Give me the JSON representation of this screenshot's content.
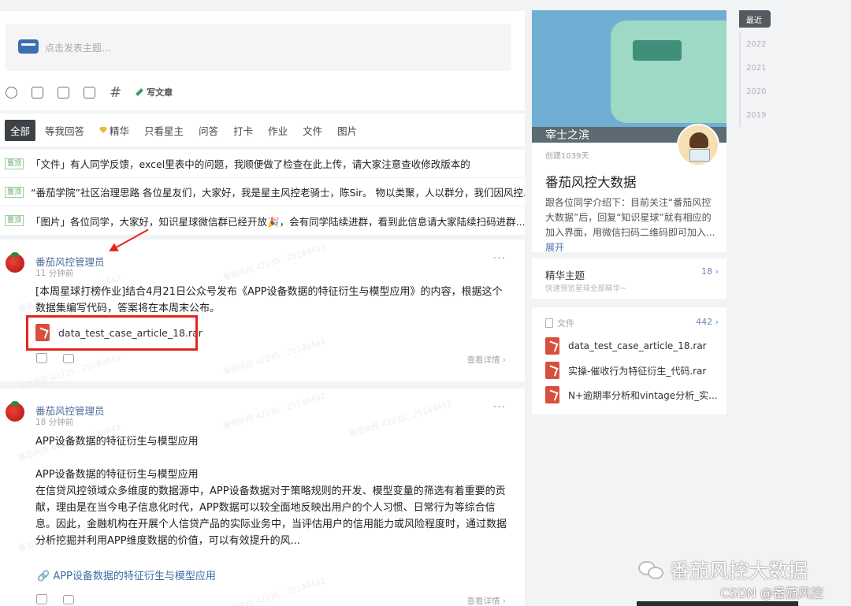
{
  "composer": {
    "placeholder": "点击发表主题...",
    "tools": [
      "smile-icon",
      "image-icon",
      "document-icon",
      "video-icon",
      "hashtag-icon"
    ],
    "hash_glyph": "#",
    "write_label": "写文章"
  },
  "tabs": [
    {
      "label": "全部",
      "active": true
    },
    {
      "label": "等我回答",
      "active": false
    },
    {
      "label": "精华",
      "active": false
    },
    {
      "label": "只看星主",
      "active": false
    },
    {
      "label": "问答",
      "active": false
    },
    {
      "label": "打卡",
      "active": false
    },
    {
      "label": "作业",
      "active": false
    },
    {
      "label": "文件",
      "active": false
    },
    {
      "label": "图片",
      "active": false
    }
  ],
  "pinned": {
    "badge": "置顶",
    "items": [
      "「文件」有人同学反馈，excel里表中的问题，我顺便做了检查在此上传，请大家注意查收修改版本的",
      "“番茄学院”社区治理思路 各位星友们，大家好，我是星主风控老骑士，陈Sir。 物以类聚，人以群分，我们因风控...",
      "「图片」各位同学，大家好，知识星球微信群已经开放🎉，会有同学陆续进群，看到此信息请大家陆续扫码进群..."
    ]
  },
  "posts": [
    {
      "author": "番茄风控管理员",
      "time": "11 分钟前",
      "more": "···",
      "text": "[本周星球打榜作业]结合4月21日公众号发布《APP设备数据的特征衍生与模型应用》的内容，根据这个数据集编写代码，答案将在本周末公布。",
      "attachment": "data_test_case_article_18.rar",
      "detail": "查看详情 ›"
    },
    {
      "author": "番茄风控管理员",
      "time": "18 分钟前",
      "more": "···",
      "title": "APP设备数据的特征衍生与模型应用",
      "subtitle": "APP设备数据的特征衍生与模型应用",
      "body": "在信贷风控领域众多维度的数据源中，APP设备数据对于策略规则的开发、模型变量的筛选有着重要的贡献，理由是在当今电子信息化时代，APP数据可以较全面地反映出用户的个人习惯、日常行为等综合信息。因此，金融机构在开展个人信贷产品的实际业务中，当评估用户的信用能力或风险程度时，通过数据分析挖掘并利用APP维度数据的价值，可以有效提升的风...",
      "link": "APP设备数据的特征衍生与模型应用",
      "detail": "查看详情 ›"
    }
  ],
  "watermark_text": "番茄风控 42235...25184442",
  "group": {
    "banner_name": "宰士之滨",
    "created": "创建1039天",
    "title": "番茄风控大数据",
    "description": "跟各位同学介绍下：目前关注“番茄风控大数据”后，回复“知识星球”就有相应的加入界面，用微信扫码二维码即可加入...",
    "expand": "展开"
  },
  "featured": {
    "title": "精华主题",
    "count": "18",
    "subtitle": "快速预览星球全部精华~"
  },
  "files": {
    "title": "文件",
    "count": "442",
    "items": [
      "data_test_case_article_18.rar",
      "实操-催收行为特征衍生_代码.rar",
      "N+逾期率分析和vintage分析_实..."
    ]
  },
  "years": [
    {
      "label": "最近",
      "active": true
    },
    {
      "label": "2022",
      "active": false
    },
    {
      "label": "2021",
      "active": false
    },
    {
      "label": "2020",
      "active": false
    },
    {
      "label": "2019",
      "active": false
    }
  ],
  "overlay": {
    "wechat_name": "番茄风控大数据",
    "csdn": "CSDN @番茄风控"
  },
  "colors": {
    "highlight": "#e5261f",
    "link": "#3f6ea8",
    "active_tab": "#3e4247"
  }
}
